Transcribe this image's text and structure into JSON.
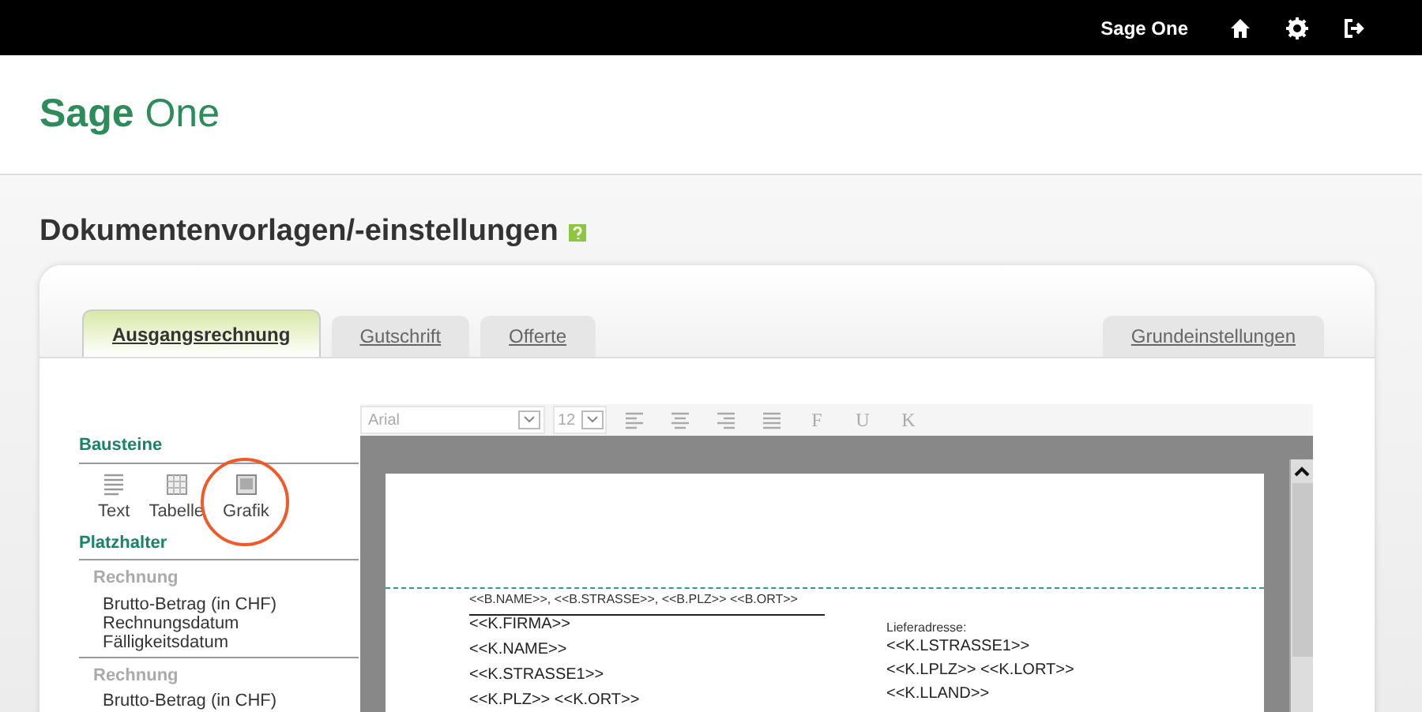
{
  "top_bar": {
    "brand": "Sage One",
    "icons": [
      {
        "kind": "home"
      },
      {
        "kind": "settings"
      },
      {
        "kind": "logout"
      }
    ]
  },
  "logo": {
    "part_1": "Sage",
    "part_2": "One"
  },
  "page_title": "Dokumentenvorlagen/-einstellungen",
  "tabs": [
    {
      "label": "Ausgangsrechnung",
      "selected": true
    },
    {
      "label": "Gutschrift",
      "selected": false
    },
    {
      "label": "Offerte",
      "selected": false
    },
    {
      "label": "Grundeinstellungen",
      "selected": false
    }
  ],
  "bausteine": {
    "title": "Bausteine",
    "tools": [
      {
        "label": "Text",
        "kind": "text",
        "highlighted": false
      },
      {
        "label": "Tabelle",
        "kind": "table",
        "highlighted": false
      },
      {
        "label": "Grafik",
        "kind": "image",
        "highlighted": true
      }
    ]
  },
  "platzhalter": {
    "title": "Platzhalter",
    "groups": [
      {
        "title": "Rechnung",
        "items": [
          "Brutto-Betrag (in CHF)",
          "Rechnungsdatum",
          "Fälligkeitsdatum"
        ]
      },
      {
        "title": "Rechnung",
        "items": [
          "Brutto-Betrag (in CHF)"
        ]
      }
    ]
  },
  "toolbar": {
    "font": "Arial",
    "size": "12",
    "buttons": [
      {
        "kind": "align-left"
      },
      {
        "kind": "align-center"
      },
      {
        "kind": "align-right"
      },
      {
        "kind": "justify"
      },
      {
        "kind": "letter",
        "glyph": "F"
      },
      {
        "kind": "letter",
        "glyph": "U"
      },
      {
        "kind": "letter",
        "glyph": "K"
      }
    ]
  },
  "document": {
    "sender_line": "<<B.NAME>>, <<B.STRASSE>>, <<B.PLZ>> <<B.ORT>>",
    "address_lines": [
      "<<K.FIRMA>>",
      "<<K.NAME>>",
      "<<K.STRASSE1>>",
      "<<K.PLZ>> <<K.ORT>>"
    ],
    "delivery_label": "Lieferadresse:",
    "delivery_lines": [
      "<<K.LSTRASSE1>>",
      "<<K.LPLZ>> <<K.LORT>>",
      "<<K.LLAND>>"
    ]
  }
}
